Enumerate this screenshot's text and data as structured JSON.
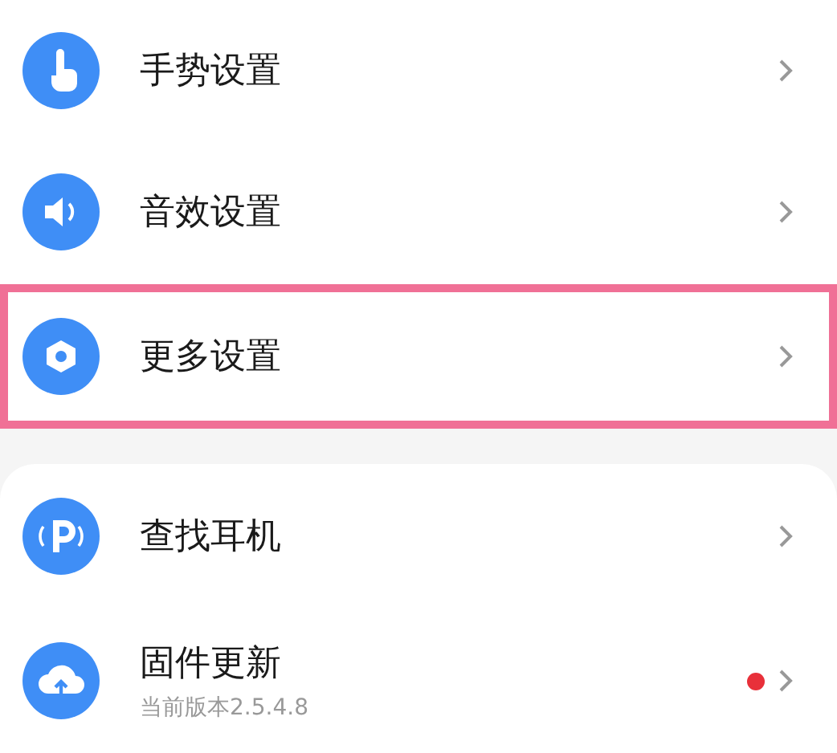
{
  "groups": [
    {
      "items": [
        {
          "label": "手势设置",
          "highlighted": false,
          "update_dot": false
        },
        {
          "label": "音效设置",
          "highlighted": false,
          "update_dot": false
        },
        {
          "label": "更多设置",
          "highlighted": true,
          "update_dot": false
        }
      ]
    },
    {
      "items": [
        {
          "label": "查找耳机",
          "highlighted": false,
          "update_dot": false
        },
        {
          "label": "固件更新",
          "subtitle": "当前版本2.5.4.8",
          "highlighted": false,
          "update_dot": true
        }
      ]
    }
  ]
}
